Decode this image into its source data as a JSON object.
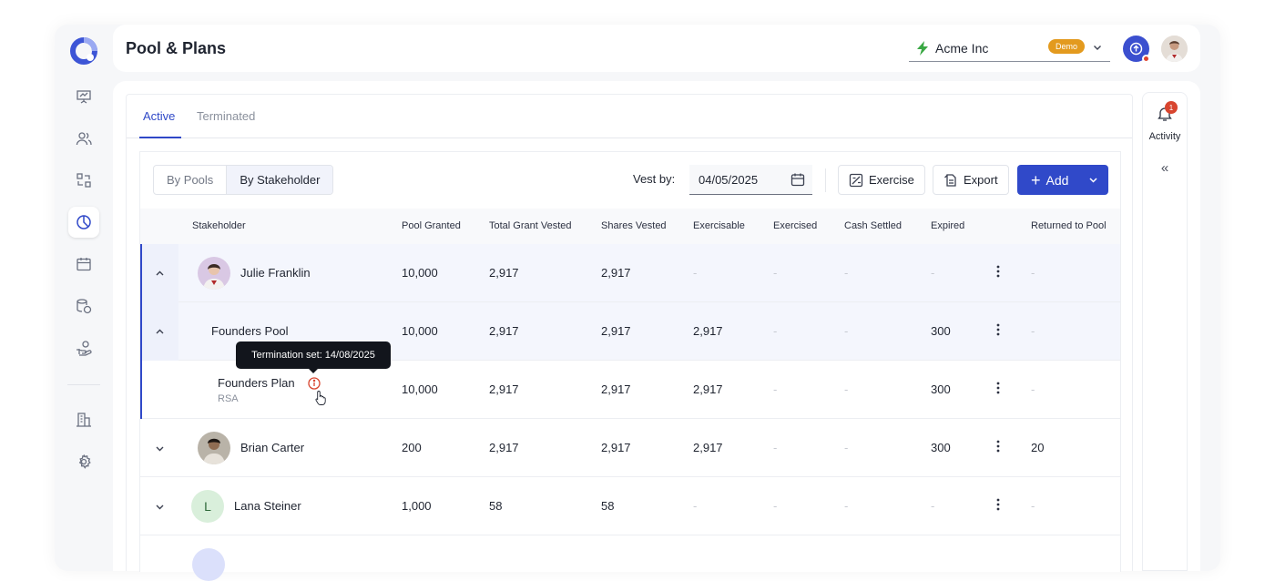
{
  "header": {
    "title": "Pool & Plans",
    "company": "Acme Inc",
    "badge": "Demo"
  },
  "tabs": [
    {
      "label": "Active",
      "active": true
    },
    {
      "label": "Terminated",
      "active": false
    }
  ],
  "view_toggle": [
    {
      "label": "By Pools",
      "active": false
    },
    {
      "label": "By Stakeholder",
      "active": true
    }
  ],
  "toolbar": {
    "vest_label": "Vest by:",
    "vest_date": "04/05/2025",
    "exercise_label": "Exercise",
    "export_label": "Export",
    "add_label": "Add"
  },
  "table": {
    "columns": [
      "Stakeholder",
      "Pool Granted",
      "Total Grant Vested",
      "Shares Vested",
      "Exercisable",
      "Exercised",
      "Cash Settled",
      "Expired",
      "Returned to Pool"
    ],
    "rows": [
      {
        "name": "Julie Franklin",
        "pool_granted": "10,000",
        "total_grant_vested": "2,917",
        "shares_vested": "2,917",
        "exercisable": "-",
        "exercised": "-",
        "cash_settled": "-",
        "expired": "-",
        "returned": "-"
      },
      {
        "name": "Founders Pool",
        "pool_granted": "10,000",
        "total_grant_vested": "2,917",
        "shares_vested": "2,917",
        "exercisable": "2,917",
        "exercised": "-",
        "cash_settled": "-",
        "expired": "300",
        "returned": "-"
      },
      {
        "name": "Founders Plan",
        "sub": "RSA",
        "pool_granted": "10,000",
        "total_grant_vested": "2,917",
        "shares_vested": "2,917",
        "exercisable": "2,917",
        "exercised": "-",
        "cash_settled": "-",
        "expired": "300",
        "returned": "-"
      },
      {
        "name": "Brian Carter",
        "pool_granted": "200",
        "total_grant_vested": "2,917",
        "shares_vested": "2,917",
        "exercisable": "2,917",
        "exercised": "-",
        "cash_settled": "-",
        "expired": "300",
        "returned": "20"
      },
      {
        "name": "Lana Steiner",
        "initial": "L",
        "pool_granted": "1,000",
        "total_grant_vested": "58",
        "shares_vested": "58",
        "exercisable": "-",
        "exercised": "-",
        "cash_settled": "-",
        "expired": "-",
        "returned": "-"
      }
    ]
  },
  "tooltip": {
    "text": "Termination set: 14/08/2025"
  },
  "activity": {
    "label": "Activity",
    "count": "1"
  },
  "colors": {
    "primary": "#3049c9",
    "demo_badge": "#e39a1e",
    "notification": "#d8452f",
    "selected_row": "#f4f6fd"
  }
}
